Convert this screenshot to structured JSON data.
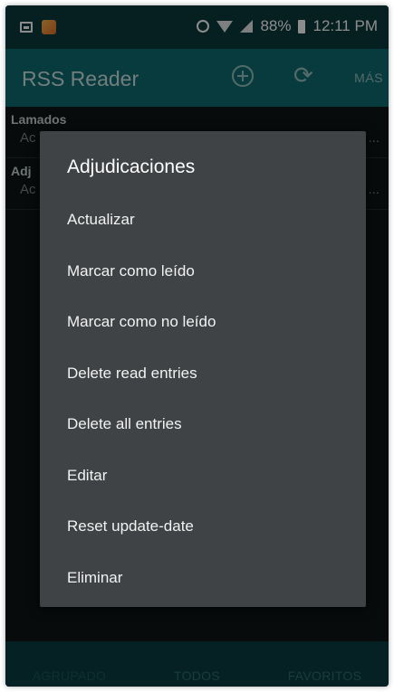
{
  "status_bar": {
    "battery": "88%",
    "time": "12:11 PM",
    "icons": [
      "screenshot-icon",
      "app-notification-icon",
      "alarm-icon",
      "wifi-icon",
      "signal-icon",
      "battery-icon"
    ]
  },
  "app_bar": {
    "title": "RSS Reader",
    "more_label": "MÁS",
    "icons": [
      "add-circle-icon",
      "refresh-icon"
    ]
  },
  "list": {
    "items": [
      {
        "title": "Lamados",
        "subtitle": "Ac",
        "trailing": "..."
      },
      {
        "title": "Adj",
        "subtitle": "Ac",
        "trailing": "..."
      }
    ]
  },
  "dialog": {
    "title": "Adjudicaciones",
    "items": [
      "Actualizar",
      "Marcar como leído",
      "Marcar como no leído",
      "Delete read entries",
      "Delete all entries",
      "Editar",
      "Reset update-date",
      "Eliminar"
    ]
  },
  "tab_bar": {
    "tabs": [
      "AGRUPADO",
      "TODOS",
      "FAVORITOS"
    ],
    "active": "AGRUPADO"
  },
  "colors": {
    "status_bar": "#0c3b3f",
    "app_bar": "#0f6c70",
    "dialog": "#3f4345",
    "background": "#101415"
  }
}
